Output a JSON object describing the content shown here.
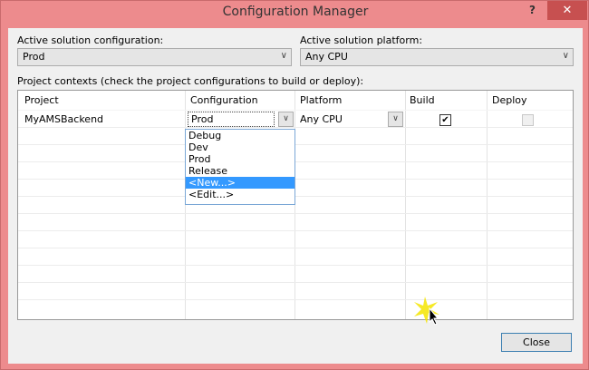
{
  "window": {
    "title": "Configuration Manager",
    "help": "?",
    "close": "✕"
  },
  "solution": {
    "config_label": "Active solution configuration:",
    "config_value": "Prod",
    "platform_label": "Active solution platform:",
    "platform_value": "Any CPU"
  },
  "contexts_label": "Project contexts (check the project configurations to build or deploy):",
  "grid": {
    "headers": [
      "Project",
      "Configuration",
      "Platform",
      "Build",
      "Deploy"
    ],
    "row": {
      "project": "MyAMSBackend",
      "configuration": "Prod",
      "platform": "Any CPU",
      "build": true,
      "deploy": false
    }
  },
  "dropdown": {
    "options": [
      "Debug",
      "Dev",
      "Prod",
      "Release",
      "<New...>",
      "<Edit...>"
    ],
    "highlighted": "<New...>"
  },
  "close_button": "Close"
}
